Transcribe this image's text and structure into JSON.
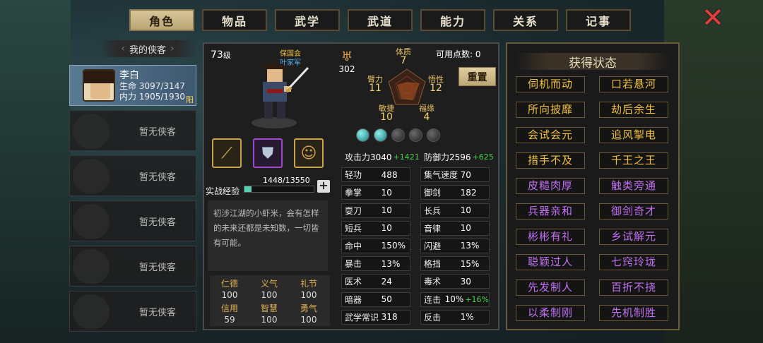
{
  "tabs": [
    "角色",
    "物品",
    "武学",
    "武道",
    "能力",
    "关系",
    "记事"
  ],
  "active_tab": 0,
  "list": {
    "title": "我的侠客",
    "empty_label": "暂无侠客",
    "hero": {
      "name": "李白",
      "hp_label": "生命",
      "hp": "3097/3147",
      "mp_label": "内力",
      "mp": "1905/1930",
      "tag": "阳"
    }
  },
  "profile": {
    "level": "73",
    "level_unit": "级",
    "faction1": "保国会",
    "faction2": "叶家军",
    "exp_label": "实战经验",
    "exp": "1448/13550",
    "exp_fraction": 0.107,
    "desc": "初涉江湖的小虾米，会有怎样的未来还都是未知数，一切皆有可能。",
    "virtues": [
      {
        "k": "仁德",
        "v": "100"
      },
      {
        "k": "义气",
        "v": "100"
      },
      {
        "k": "礼节",
        "v": "100"
      },
      {
        "k": "信用",
        "v": "59"
      },
      {
        "k": "智慧",
        "v": "100"
      },
      {
        "k": "勇气",
        "v": "100"
      }
    ]
  },
  "power": "302",
  "attrs": {
    "tizhi": {
      "k": "体质",
      "v": "7"
    },
    "bili": {
      "k": "臂力",
      "v": "11"
    },
    "wuxing": {
      "k": "悟性",
      "v": "12"
    },
    "minjie": {
      "k": "敏捷",
      "v": "10"
    },
    "fuyuan": {
      "k": "福缘",
      "v": "4"
    }
  },
  "avail": "可用点数: 0",
  "reset": "重置",
  "stats": [
    [
      {
        "k": "攻击力",
        "v": "3040",
        "g": "+1421"
      },
      {
        "k": "防御力",
        "v": "2596",
        "g": "+625"
      }
    ],
    [
      {
        "k": "轻功",
        "v": "488"
      },
      {
        "k": "集气速度",
        "v": "70"
      }
    ],
    [
      {
        "k": "拳掌",
        "v": "10"
      },
      {
        "k": "御剑",
        "v": "182"
      }
    ],
    [
      {
        "k": "耍刀",
        "v": "10"
      },
      {
        "k": "长兵",
        "v": "10"
      }
    ],
    [
      {
        "k": "短兵",
        "v": "10"
      },
      {
        "k": "音律",
        "v": "10"
      }
    ],
    [
      {
        "k": "命中",
        "v": "150%"
      },
      {
        "k": "闪避",
        "v": "13%"
      }
    ],
    [
      {
        "k": "暴击",
        "v": "13%"
      },
      {
        "k": "格挡",
        "v": "15%"
      }
    ],
    [
      {
        "k": "医术",
        "v": "24"
      },
      {
        "k": "毒术",
        "v": "30"
      }
    ],
    [
      {
        "k": "暗器",
        "v": "50"
      },
      {
        "k": "连击",
        "v": "10%",
        "g": "+16%"
      }
    ],
    [
      {
        "k": "武学常识",
        "v": "318"
      },
      {
        "k": "反击",
        "v": "1%"
      }
    ]
  ],
  "buffs_title": "获得状态",
  "buffs": [
    {
      "t": "伺机而动",
      "c": "gold"
    },
    {
      "t": "口若悬河",
      "c": "gold"
    },
    {
      "t": "所向披靡",
      "c": "gold"
    },
    {
      "t": "劫后余生",
      "c": "gold"
    },
    {
      "t": "会试会元",
      "c": "gold"
    },
    {
      "t": "追风掣电",
      "c": "gold"
    },
    {
      "t": "措手不及",
      "c": "gold"
    },
    {
      "t": "千王之王",
      "c": "gold"
    },
    {
      "t": "皮糙肉厚",
      "c": "pur"
    },
    {
      "t": "触类旁通",
      "c": "pur"
    },
    {
      "t": "兵器亲和",
      "c": "pur"
    },
    {
      "t": "御剑奇才",
      "c": "pur"
    },
    {
      "t": "彬彬有礼",
      "c": "pur"
    },
    {
      "t": "乡试解元",
      "c": "pur"
    },
    {
      "t": "聪颖过人",
      "c": "pur"
    },
    {
      "t": "七窍玲珑",
      "c": "pur"
    },
    {
      "t": "先发制人",
      "c": "pur"
    },
    {
      "t": "百折不挠",
      "c": "pur"
    },
    {
      "t": "以柔制刚",
      "c": "pur"
    },
    {
      "t": "先机制胜",
      "c": "pur"
    }
  ]
}
